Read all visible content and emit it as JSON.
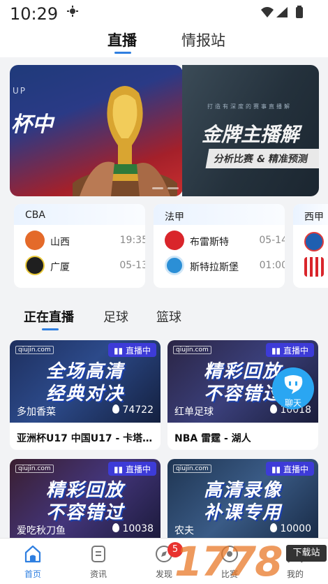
{
  "status_bar": {
    "time": "10:29"
  },
  "top_tabs": [
    {
      "label": "直播",
      "active": true
    },
    {
      "label": "情报站",
      "active": false
    }
  ],
  "banners": [
    {
      "corner_text": "UP",
      "side_text": "杯中"
    },
    {
      "tagline": "打造有深度的赛事直播解",
      "headline": "金牌主播解",
      "subline": "分析比赛 & 精准预测"
    }
  ],
  "match_cards": [
    {
      "league": "CBA",
      "home": {
        "name": "山西",
        "time": "19:35"
      },
      "away": {
        "name": "广厦",
        "time": "05-13"
      }
    },
    {
      "league": "法甲",
      "home": {
        "name": "布雷斯特",
        "time": "05-14"
      },
      "away": {
        "name": "斯特拉斯堡",
        "time": "01:00"
      }
    },
    {
      "league": "西甲"
    }
  ],
  "section_tabs": [
    {
      "label": "正在直播",
      "active": true
    },
    {
      "label": "足球",
      "active": false
    },
    {
      "label": "篮球",
      "active": false
    }
  ],
  "streams": [
    {
      "watermark": "qiujin.com",
      "badge": "直播中",
      "big1": "全场高清",
      "big2": "经典对决",
      "anchor": "多加香菜",
      "heat": "74722",
      "title": "亚洲杯U17 中国U17 - 卡塔..."
    },
    {
      "watermark": "qiujin.com",
      "badge": "直播中",
      "big1": "精彩回放",
      "big2": "不容错过",
      "anchor": "红单足球",
      "heat": "10018",
      "title": "NBA 雷霆 - 湖人"
    },
    {
      "watermark": "qiujin.com",
      "badge": "直播中",
      "big1": "精彩回放",
      "big2": "不容错过",
      "anchor": "爱吃秋刀鱼",
      "heat": "10038",
      "title": ""
    },
    {
      "watermark": "qiujin.com",
      "badge": "直播中",
      "big1": "高清录像",
      "big2": "补课专用",
      "anchor": "农夫",
      "heat": "10000",
      "title": ""
    }
  ],
  "chat_fab": {
    "label": "聊天"
  },
  "bottom_nav": [
    {
      "label": "首页",
      "icon": "home-icon",
      "active": true
    },
    {
      "label": "资讯",
      "icon": "news-icon",
      "active": false
    },
    {
      "label": "发现",
      "icon": "discover-icon",
      "active": false,
      "badge": "5"
    },
    {
      "label": "比赛",
      "icon": "match-icon",
      "active": false
    },
    {
      "label": "我的",
      "icon": "profile-icon",
      "active": false
    }
  ],
  "site_watermark": {
    "digits": "1778",
    "download": "下载站"
  },
  "colors": {
    "accent": "#2f7fe0",
    "live_badge": "#3d3bd8",
    "badge_red": "#e8322f",
    "chat": "#2aa6f2"
  }
}
